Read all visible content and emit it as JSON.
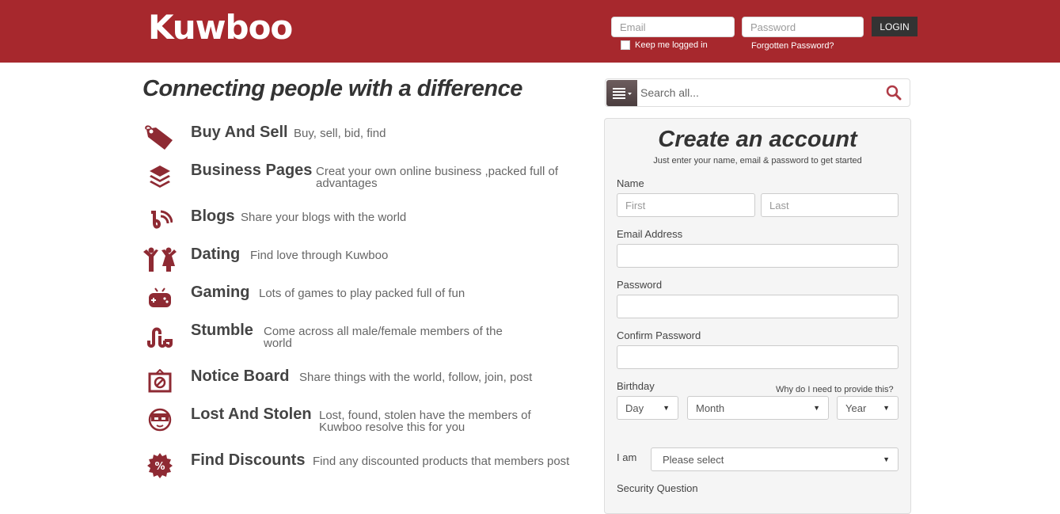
{
  "header": {
    "logo": "Kuwboo",
    "email_placeholder": "Email",
    "password_placeholder": "Password",
    "login_label": "LOGIN",
    "keep_logged_in": "Keep me logged in",
    "forgotten_password": "Forgotten Password?"
  },
  "tagline": "Connecting people with a difference",
  "features": [
    {
      "icon": "tag-icon",
      "title": "Buy And Sell",
      "desc": "Buy, sell, bid, find"
    },
    {
      "icon": "layers-icon",
      "title": "Business Pages",
      "desc": "Creat your own online business ,packed full of advantages"
    },
    {
      "icon": "blog-icon",
      "title": "Blogs",
      "desc": "Share your blogs with the world"
    },
    {
      "icon": "couple-icon",
      "title": "Dating",
      "desc": "Find love through Kuwboo"
    },
    {
      "icon": "gamepad-icon",
      "title": "Gaming",
      "desc": "Lots of games to play packed full of fun"
    },
    {
      "icon": "stumbleupon-icon",
      "title": "Stumble",
      "desc": "Come across all male/female members of the world"
    },
    {
      "icon": "notice-board-icon",
      "title": "Notice Board",
      "desc": "Share things with the world, follow, join, post"
    },
    {
      "icon": "thief-icon",
      "title": "Lost And Stolen",
      "desc": "Lost, found, stolen have the members of Kuwboo resolve this for you"
    },
    {
      "icon": "discount-icon",
      "title": "Find Discounts",
      "desc": "Find any discounted products that members post"
    }
  ],
  "search": {
    "placeholder": "Search all..."
  },
  "signup": {
    "title": "Create an account",
    "subtitle": "Just enter your name, email & password to get started",
    "name_label": "Name",
    "first_placeholder": "First",
    "last_placeholder": "Last",
    "email_label": "Email Address",
    "password_label": "Password",
    "confirm_label": "Confirm Password",
    "birthday_label": "Birthday",
    "why_link": "Why do I need to provide this?",
    "day": "Day",
    "month": "Month",
    "year": "Year",
    "iam_label": "I am",
    "iam_value": "Please select",
    "security_label": "Security Question"
  },
  "colors": {
    "brand": "#a7282d",
    "icon": "#8e2a33",
    "search_icon": "#b03a46"
  }
}
